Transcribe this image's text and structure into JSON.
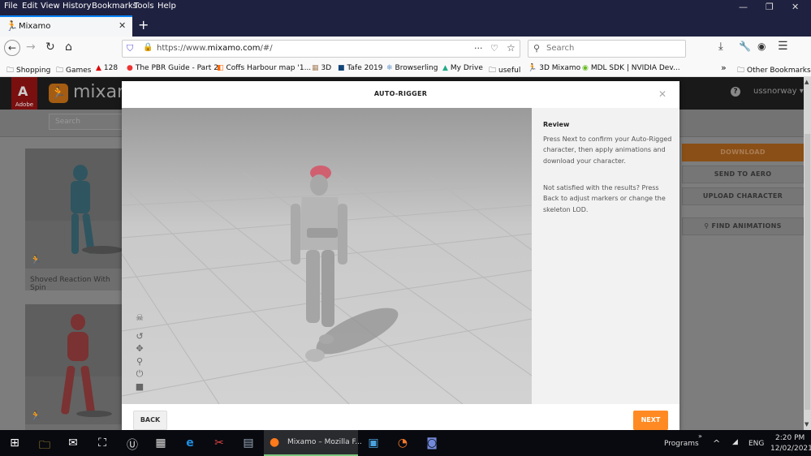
{
  "menubar": {
    "items": [
      "File",
      "Edit",
      "View",
      "History",
      "Bookmarks",
      "Tools",
      "Help"
    ]
  },
  "window_controls": {
    "minimize": "—",
    "restore": "❐",
    "close": "✕"
  },
  "tab": {
    "title": "Mixamo",
    "close": "✕",
    "new_tab": "+"
  },
  "navbar": {
    "url_prefix": "https://www.",
    "url_domain": "mixamo.com",
    "url_suffix": "/#/",
    "page_actions": "···",
    "search_placeholder": "Search"
  },
  "bookmarks": [
    {
      "label": "Shopping",
      "icon": "folder-icon"
    },
    {
      "label": "Games",
      "icon": "folder-icon"
    },
    {
      "label": "128",
      "icon": "adobe-icon"
    },
    {
      "label": "The PBR Guide - Part 2",
      "icon": "substance-icon"
    },
    {
      "label": "Coffs Harbour map '1...",
      "icon": "map-icon"
    },
    {
      "label": "3D",
      "icon": "image-icon"
    },
    {
      "label": "Tafe 2019",
      "icon": "lightroom-icon"
    },
    {
      "label": "Browserling",
      "icon": "browserling-icon"
    },
    {
      "label": "My Drive",
      "icon": "drive-icon"
    },
    {
      "label": "useful",
      "icon": "folder-icon"
    },
    {
      "label": "3D Mixamo",
      "icon": "mixamo-icon"
    },
    {
      "label": "MDL SDK | NVIDIA Dev...",
      "icon": "nvidia-icon"
    }
  ],
  "bookmarks_overflow": "»",
  "other_bookmarks": "Other Bookmarks",
  "mixamo": {
    "adobe_label": "Adobe",
    "brand": "mixamo",
    "search_placeholder": "Search",
    "help": "?",
    "username": "ussnorway",
    "cards": [
      {
        "label": "Shoved Reaction With Spin",
        "color": "#2f5560"
      },
      {
        "label": "",
        "color": "#7a3232"
      }
    ],
    "actions": {
      "download": "DOWNLOAD",
      "send_to_aero": "SEND TO AERO",
      "upload_character": "UPLOAD CHARACTER",
      "find_animations": "FIND ANIMATIONS"
    }
  },
  "modal": {
    "title": "AUTO-RIGGER",
    "close": "✕",
    "review_heading": "Review",
    "review_text_1": "Press Next to confirm your Auto-Rigged character, then apply animations and download your character.",
    "review_text_2": "Not satisfied with the results? Press Back to adjust markers or change the skeleton LOD.",
    "back_label": "BACK",
    "next_label": "NEXT",
    "accent": "#ff8a23",
    "viewer_tools": [
      "skeleton-icon",
      "rotate-icon",
      "pan-icon",
      "zoom-icon",
      "power-icon",
      "camera-icon"
    ]
  },
  "taskbar": {
    "active_window": "Mixamo – Mozilla F...",
    "programs": "Programs",
    "programs_chevron": "»",
    "tray_up": "^",
    "lang": "ENG",
    "time": "2:20 PM",
    "date": "12/02/2021"
  }
}
